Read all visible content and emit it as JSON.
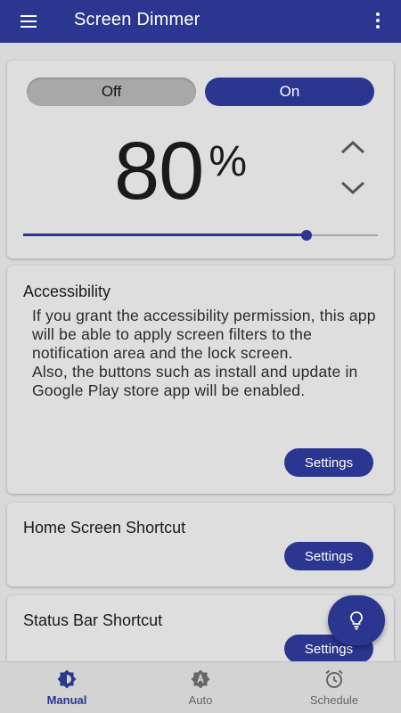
{
  "appbar": {
    "title": "Screen Dimmer"
  },
  "dimmer": {
    "off_label": "Off",
    "on_label": "On",
    "state": "On",
    "value": "80",
    "unit": "%",
    "slider_fraction": 0.8
  },
  "cards": {
    "accessibility": {
      "title": "Accessibility",
      "body": "If you grant the accessibility permission, this app will be able to apply screen filters to the notification area and the lock screen.\nAlso, the buttons such as install and update in Google Play store app will be enabled.",
      "button": "Settings"
    },
    "home_shortcut": {
      "title": "Home Screen Shortcut",
      "button": "Settings"
    },
    "status_shortcut": {
      "title": "Status Bar Shortcut",
      "button": "Settings"
    }
  },
  "bottom_nav": {
    "items": [
      {
        "label": "Manual",
        "icon": "brightness-icon",
        "active": true
      },
      {
        "label": "Auto",
        "icon": "auto-brightness-icon",
        "active": false
      },
      {
        "label": "Schedule",
        "icon": "alarm-clock-icon",
        "active": false
      }
    ]
  },
  "fab": {
    "icon": "lightbulb-icon"
  },
  "colors": {
    "primary": "#2a3690",
    "background": "#d9d9d9",
    "card": "#dedede"
  }
}
